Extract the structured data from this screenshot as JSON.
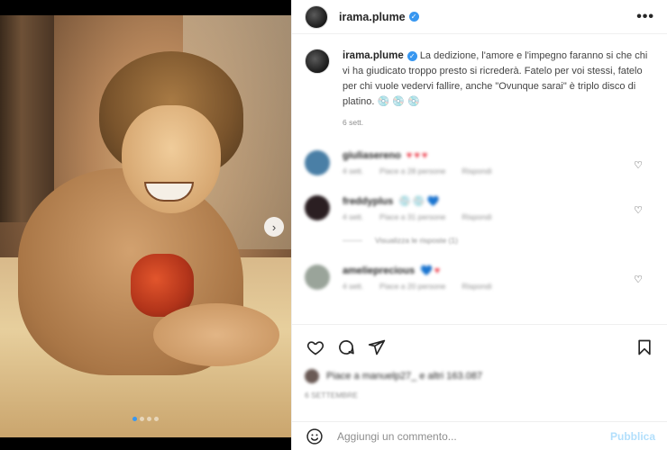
{
  "post": {
    "username": "irama.plume",
    "verified": true
  },
  "header": {
    "more_icon": "more-horizontal-icon",
    "more_label": "•••"
  },
  "caption": {
    "username": "irama.plume",
    "text": "La dedizione, l'amore e l'impegno faranno si che chi vi ha giudicato troppo presto si ricrederà. Fatelo per voi stessi, fatelo per chi vuole vedervi fallire, anche \"Ovunque sarai\" è triplo disco di platino. 💿 💿 💿",
    "time": "6 sett."
  },
  "comments": [
    {
      "username": "giuliasereno",
      "emojis": "♥♥♥",
      "avatar_color": "#4a7fa6",
      "meta": [
        "4 sett.",
        "Piace a 28 persone",
        "Rispondi"
      ]
    },
    {
      "username": "freddyplus",
      "emojis": "💿💿💙",
      "avatar_color": "#2b1f22",
      "meta": [
        "4 sett.",
        "Piace a 31 persone",
        "Rispondi"
      ],
      "replies": "Visualizza le risposte (1)"
    },
    {
      "username": "amelieprecious",
      "emojis": "💙♥",
      "avatar_color": "#9aa49a",
      "meta": [
        "4 sett.",
        "Piace a 20 persone",
        "Rispondi"
      ]
    }
  ],
  "media": {
    "slides": 4,
    "active_slide": 1,
    "next_label": "›",
    "active_color": "#3897f0"
  },
  "likes": {
    "text": "Piace a manuelp27_ e altri 163.087"
  },
  "date": {
    "text": "6 SETTEMBRE"
  },
  "composer": {
    "placeholder": "Aggiungi un commento...",
    "publish_label": "Pubblica"
  },
  "colors": {
    "accent": "#3897f0",
    "like": "#ed4956",
    "publish_disabled": "#b2dffc"
  }
}
